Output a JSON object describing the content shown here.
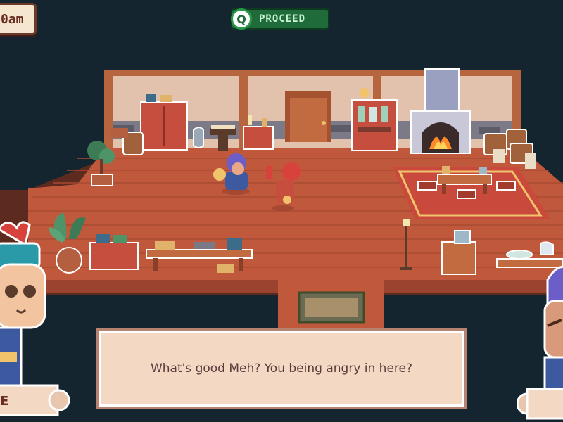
{
  "hud": {
    "clock_text": "0am",
    "proceed_key": "Q",
    "proceed_label": "PROCEED"
  },
  "dialog": {
    "text": "What's good Meh? You being angry in here?"
  },
  "speaker_left": {
    "name_fragment": "E"
  },
  "colors": {
    "background": "#14252f",
    "floor": "#c0593c",
    "wall": "#e3c2ad",
    "rug": "#c94a3c",
    "proceed_bg": "#1f6b3a",
    "dialog_bg": "#f3d9c4"
  }
}
